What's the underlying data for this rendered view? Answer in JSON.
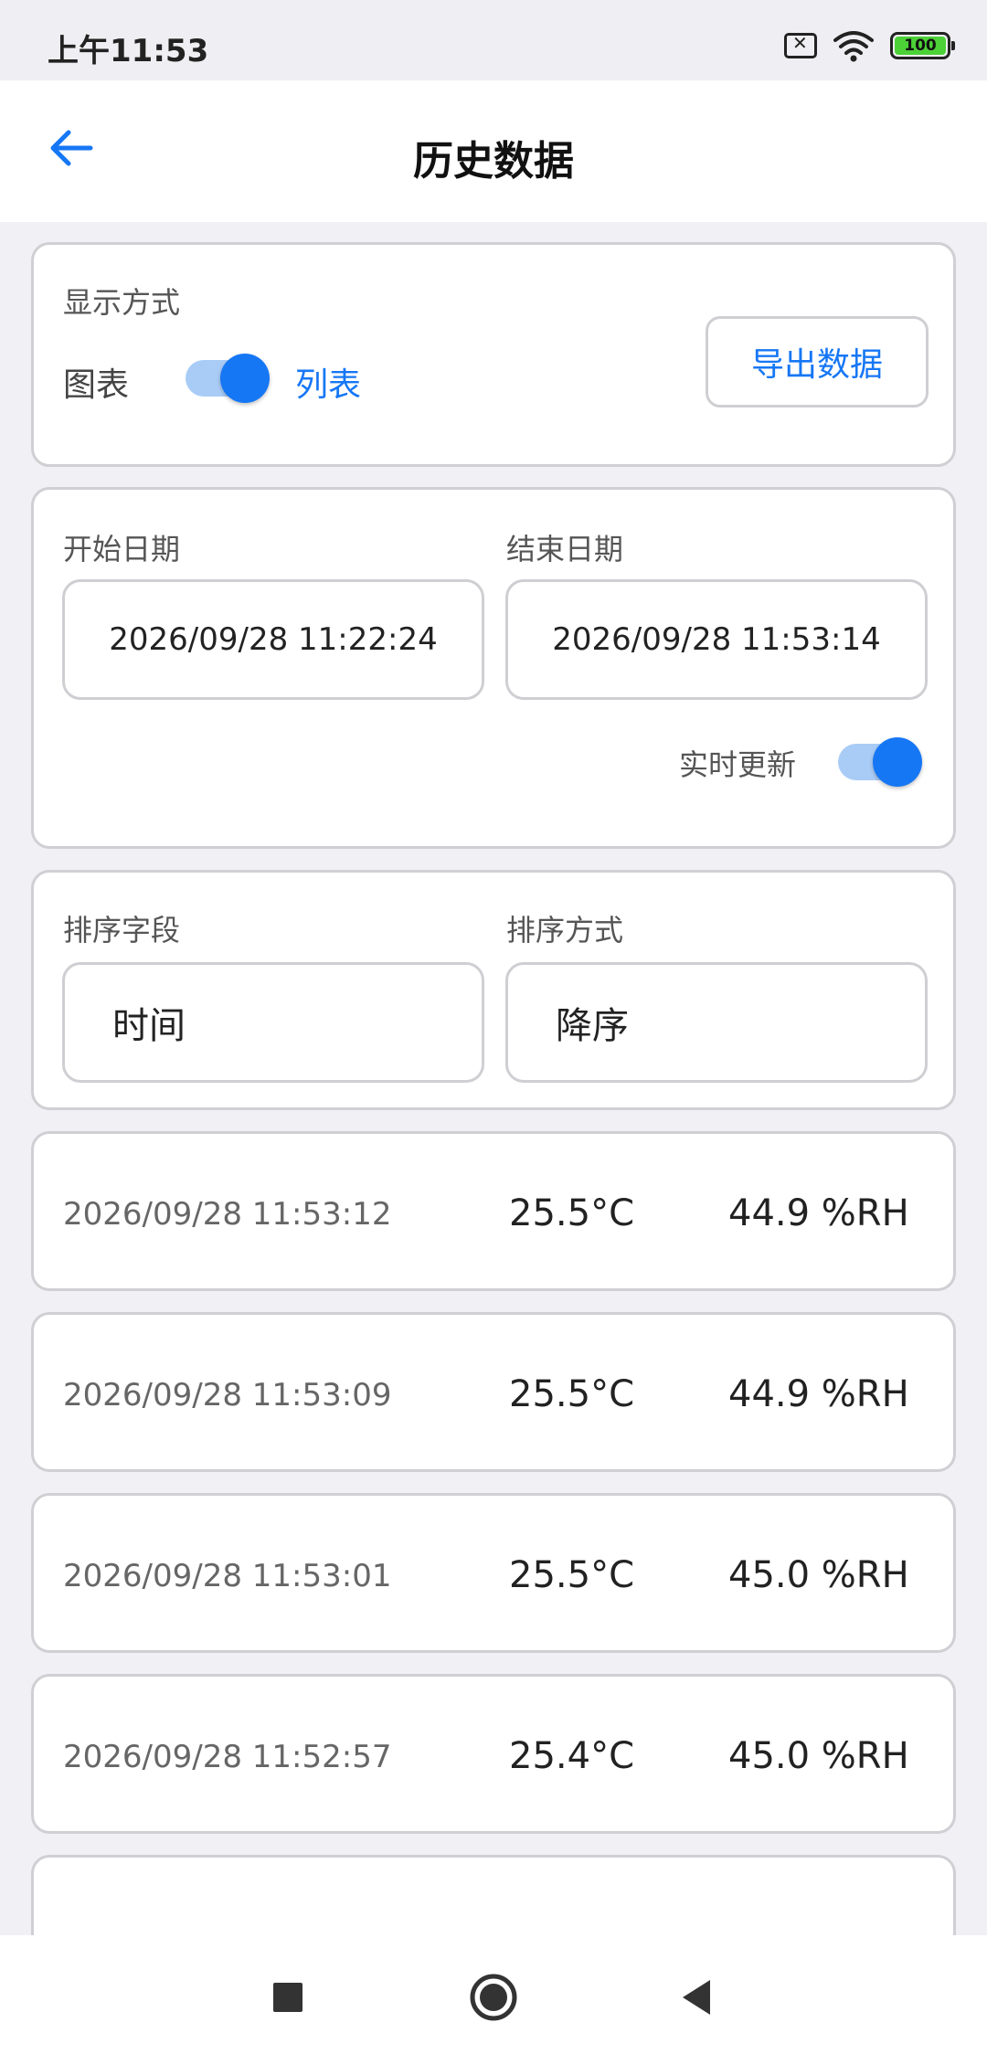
{
  "status_bar": {
    "time": "上午11:53",
    "battery_level": "100",
    "icons": [
      "sim-off-icon",
      "wifi-icon",
      "battery-icon"
    ]
  },
  "header": {
    "title": "历史数据",
    "back_icon": "arrow-left-icon"
  },
  "display_mode": {
    "heading": "显示方式",
    "option_chart": "图表",
    "option_list": "列表",
    "toggle_on": true,
    "export_label": "导出数据"
  },
  "date_range": {
    "start_label": "开始日期",
    "start_value": "2026/09/28 11:22:24",
    "end_label": "结束日期",
    "end_value": "2026/09/28 11:53:14",
    "realtime_label": "实时更新",
    "realtime_on": true
  },
  "sorting": {
    "field_label": "排序字段",
    "field_value": "时间",
    "order_label": "排序方式",
    "order_value": "降序"
  },
  "records": [
    {
      "time": "2026/09/28 11:53:12",
      "temp": "25.5°C",
      "humidity": "44.9 %RH"
    },
    {
      "time": "2026/09/28 11:53:09",
      "temp": "25.5°C",
      "humidity": "44.9 %RH"
    },
    {
      "time": "2026/09/28 11:53:01",
      "temp": "25.5°C",
      "humidity": "45.0 %RH"
    },
    {
      "time": "2026/09/28 11:52:57",
      "temp": "25.4°C",
      "humidity": "45.0 %RH"
    }
  ],
  "colors": {
    "accent": "#1677f5",
    "toggle_track": "#a9ccf7",
    "background": "#f1f1f5"
  },
  "nav": {
    "icons": [
      "recent-apps-icon",
      "home-icon",
      "back-icon"
    ]
  }
}
